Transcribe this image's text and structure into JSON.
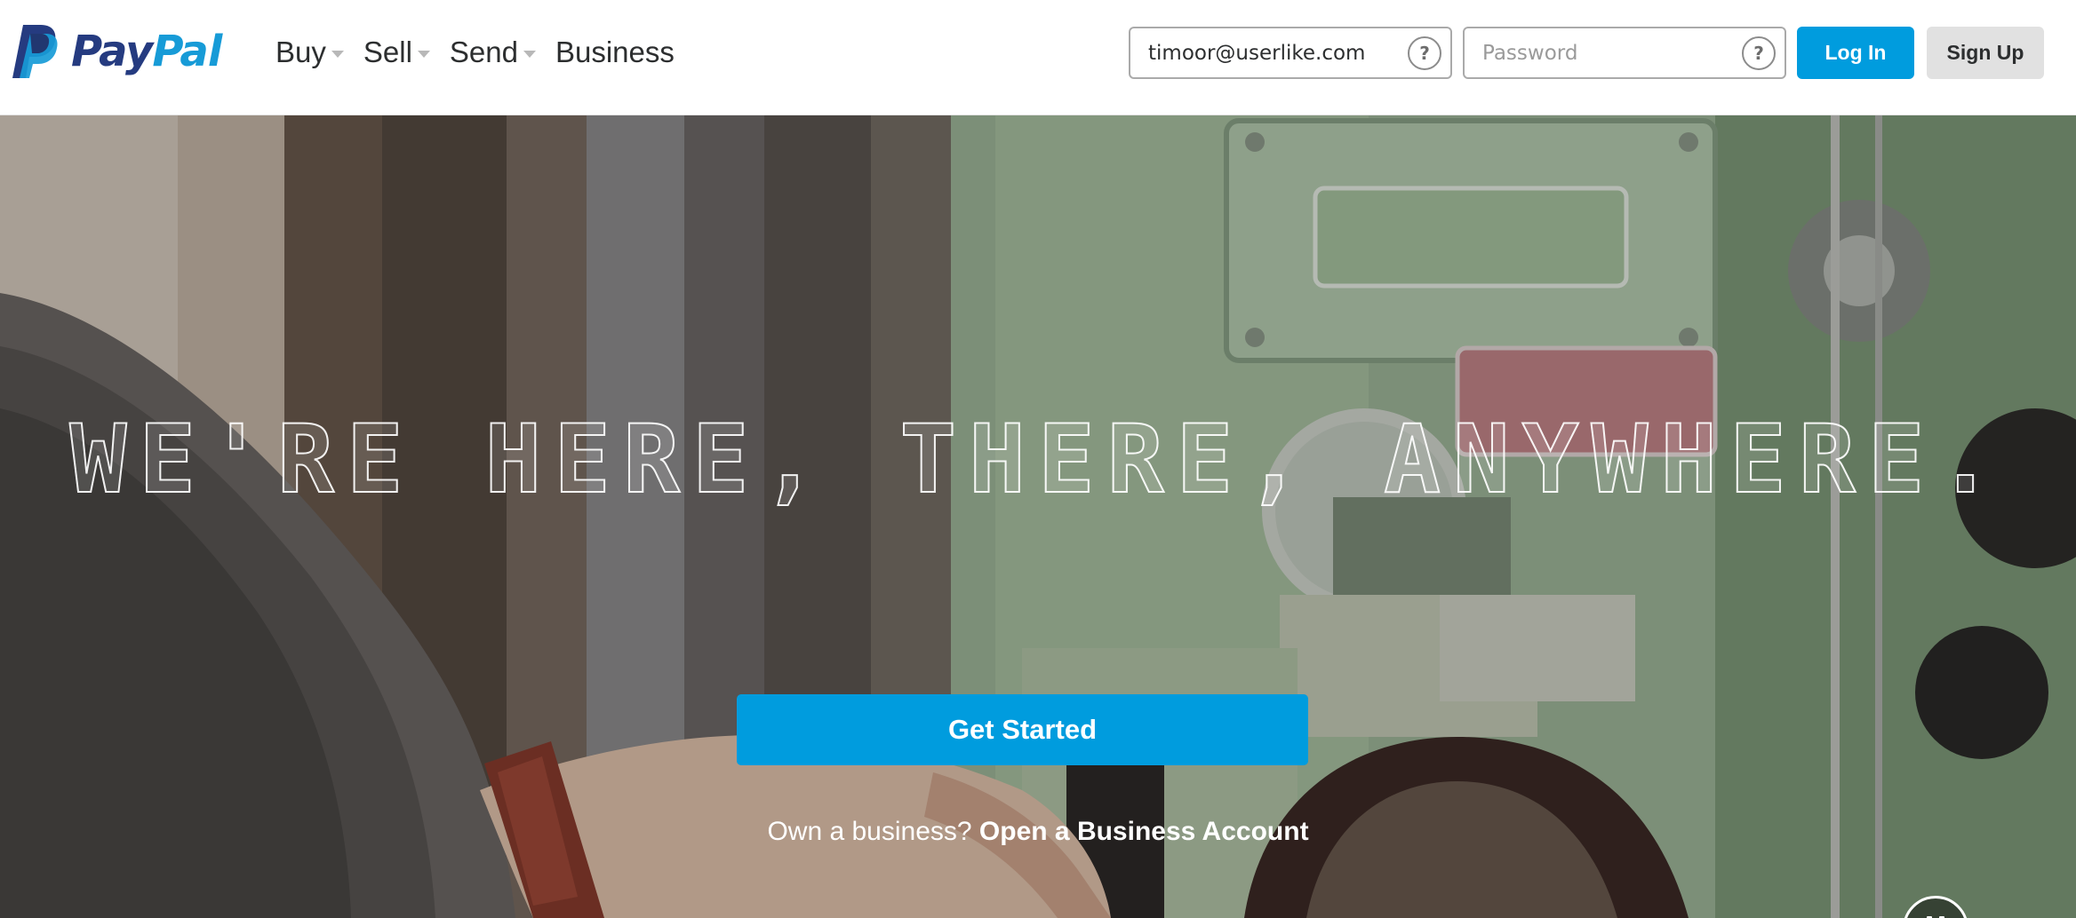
{
  "brand": {
    "name_part1": "Pay",
    "name_part2": "Pal",
    "colors": {
      "dark_blue": "#253b80",
      "light_blue": "#179bd7"
    },
    "icon": "paypal-logo-icon"
  },
  "nav": {
    "items": [
      {
        "label": "Buy",
        "has_dropdown": true
      },
      {
        "label": "Sell",
        "has_dropdown": true
      },
      {
        "label": "Send",
        "has_dropdown": true
      },
      {
        "label": "Business",
        "has_dropdown": false
      }
    ]
  },
  "login": {
    "email": {
      "value": "timoor@userlike.com",
      "placeholder": ""
    },
    "password": {
      "value": "",
      "placeholder": "Password"
    },
    "help_glyph": "?",
    "login_label": "Log In",
    "signup_label": "Sign Up"
  },
  "hero": {
    "headline": "WE'RE HERE, THERE, ANYWHERE.",
    "cta_label": "Get Started",
    "business_prompt": "Own a business?",
    "business_link": "Open a Business Account",
    "media_control": "pause-icon"
  },
  "theme": {
    "primary_button": "#009cde",
    "secondary_button": "#e1e1e1",
    "text_dark": "#2c2e2f"
  }
}
